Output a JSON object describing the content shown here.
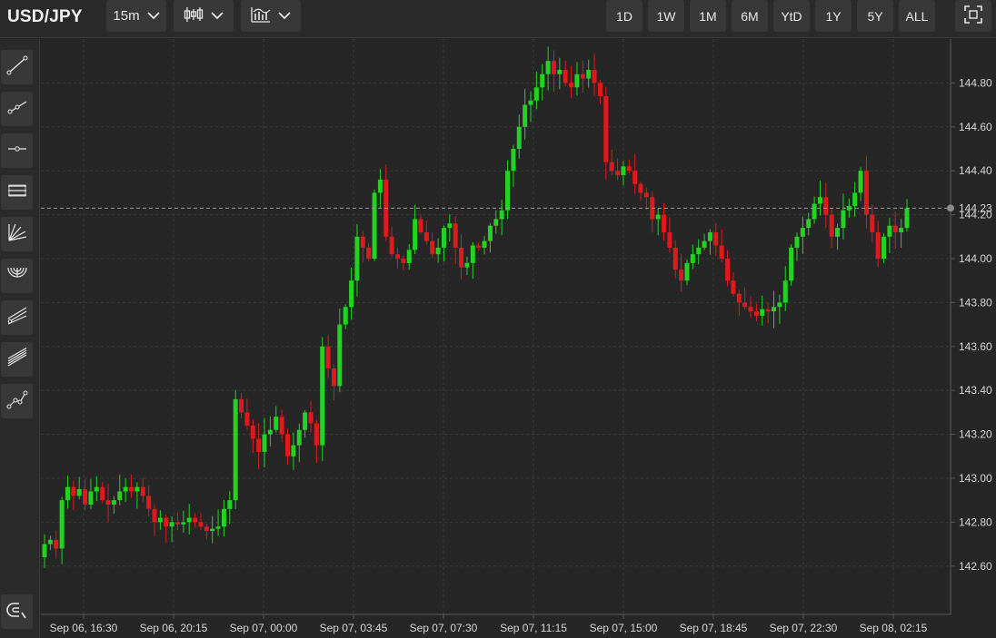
{
  "header": {
    "symbol": "USD/JPY",
    "interval": "15m",
    "ranges": [
      "1D",
      "1W",
      "1M",
      "6M",
      "YtD",
      "1Y",
      "5Y",
      "ALL"
    ]
  },
  "icons": {
    "chart_type": "candlestick-icon",
    "indicators": "indicators-icon",
    "fullscreen": "fullscreen-icon",
    "tools": [
      "trend-line-icon",
      "ray-line-icon",
      "horizontal-line-icon",
      "parallel-channel-icon",
      "fan-icon",
      "arc-icon",
      "pitchfork-icon",
      "regression-channel-icon",
      "path-icon"
    ],
    "magnet": "magnet-icon"
  },
  "colors": {
    "up": "#22d322",
    "down": "#e0191c",
    "background": "#262626",
    "grid": "#3c3c3c"
  },
  "current_price": "144.23",
  "chart_data": {
    "type": "candlestick",
    "y_ticks": [
      "144.80",
      "144.60",
      "144.40",
      "144.20",
      "144.00",
      "143.80",
      "143.60",
      "143.40",
      "143.20",
      "143.00",
      "142.80",
      "142.60"
    ],
    "x_ticks": [
      "Sep 06, 16:30",
      "Sep 06, 20:15",
      "Sep 07, 00:00",
      "Sep 07, 03:45",
      "Sep 07, 07:30",
      "Sep 07, 11:15",
      "Sep 07, 15:00",
      "Sep 07, 18:45",
      "Sep 07, 22:30",
      "Sep 08, 02:15"
    ],
    "ylim": [
      142.38,
      145.0
    ],
    "grid": true,
    "legend": "none",
    "close_series": [
      142.7,
      142.72,
      142.68,
      142.9,
      142.96,
      142.92,
      142.95,
      142.88,
      142.94,
      142.96,
      142.9,
      142.88,
      142.9,
      142.94,
      142.96,
      142.94,
      142.96,
      142.92,
      142.86,
      142.8,
      142.82,
      142.78,
      142.8,
      142.79,
      142.8,
      142.82,
      142.8,
      142.78,
      142.76,
      142.77,
      142.78,
      142.86,
      142.9,
      143.36,
      143.3,
      143.24,
      143.18,
      143.12,
      143.2,
      143.22,
      143.28,
      143.2,
      143.1,
      143.15,
      143.22,
      143.3,
      143.25,
      143.15,
      143.6,
      143.5,
      143.42,
      143.7,
      143.78,
      143.9,
      144.1,
      144.05,
      144.0,
      144.3,
      144.36,
      144.1,
      144.02,
      144.0,
      143.98,
      144.04,
      144.18,
      144.12,
      144.08,
      144.02,
      144.05,
      144.14,
      144.16,
      144.05,
      143.96,
      143.98,
      144.06,
      144.05,
      144.08,
      144.15,
      144.18,
      144.22,
      144.4,
      144.5,
      144.6,
      144.7,
      144.72,
      144.78,
      144.84,
      144.9,
      144.84,
      144.86,
      144.8,
      144.78,
      144.84,
      144.82,
      144.86,
      144.8,
      144.74,
      144.44,
      144.4,
      144.38,
      144.42,
      144.4,
      144.34,
      144.3,
      144.28,
      144.18,
      144.2,
      144.12,
      144.05,
      143.95,
      143.9,
      143.98,
      144.02,
      144.05,
      144.08,
      144.12,
      144.06,
      144.0,
      143.9,
      143.84,
      143.8,
      143.78,
      143.76,
      143.74,
      143.77,
      143.76,
      143.78,
      143.8,
      143.9,
      144.05,
      144.1,
      144.14,
      144.18,
      144.25,
      144.28,
      144.2,
      144.1,
      144.14,
      144.22,
      144.24,
      144.3,
      144.4,
      144.2,
      144.12,
      144.0,
      144.1,
      144.15,
      144.12,
      144.14,
      144.23
    ],
    "dot_last": "144.23"
  }
}
